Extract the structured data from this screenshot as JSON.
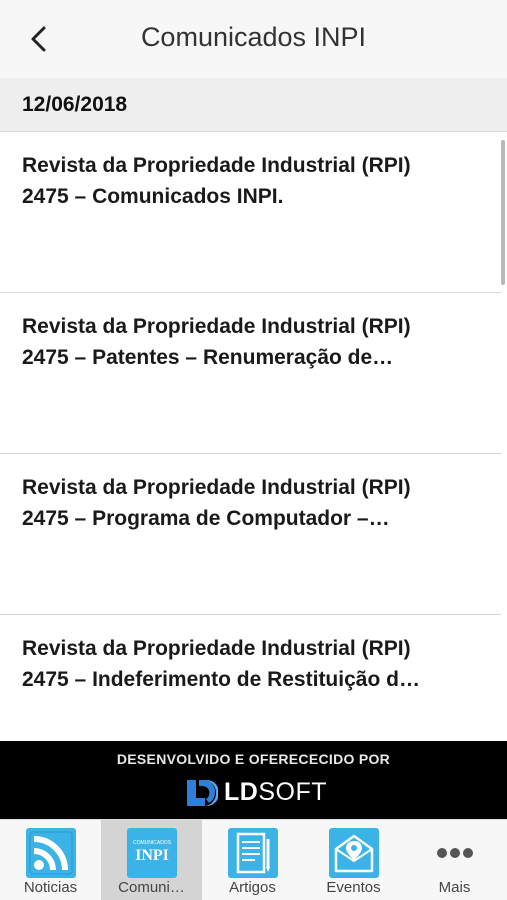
{
  "header": {
    "title": "Comunicados INPI"
  },
  "date_group": "12/06/2018",
  "items": [
    {
      "line1": "Revista da Propriedade Industrial (RPI)",
      "line2": "2475 – Comunicados INPI."
    },
    {
      "line1": "Revista da Propriedade Industrial (RPI)",
      "line2": "2475 – Patentes – Renumeração de…"
    },
    {
      "line1": "Revista da Propriedade Industrial (RPI)",
      "line2": "2475 – Programa de Computador –…"
    },
    {
      "line1": "Revista da Propriedade Industrial (RPI)",
      "line2": "2475 – Indeferimento de Restituição d…"
    }
  ],
  "banner": {
    "text": "DESENVOLVIDO E OFERECECIDO POR",
    "brand_bold": "LD",
    "brand_rest": "SOFT",
    "brand_color": "#2f7fd8"
  },
  "tabs": [
    {
      "label": "Noticias",
      "icon": "rss-icon",
      "active": false
    },
    {
      "label": "Comuni…",
      "icon": "inpi-icon",
      "active": true,
      "icon_text_small": "COMUNICADOS",
      "icon_text": "INPI"
    },
    {
      "label": "Artigos",
      "icon": "document-icon",
      "active": false
    },
    {
      "label": "Eventos",
      "icon": "event-location-icon",
      "active": false
    },
    {
      "label": "Mais",
      "icon": "more-icon",
      "active": false
    }
  ],
  "colors": {
    "tab_icon_bg": "#3bb3e6",
    "active_tab_bg": "#d4d4d4"
  }
}
